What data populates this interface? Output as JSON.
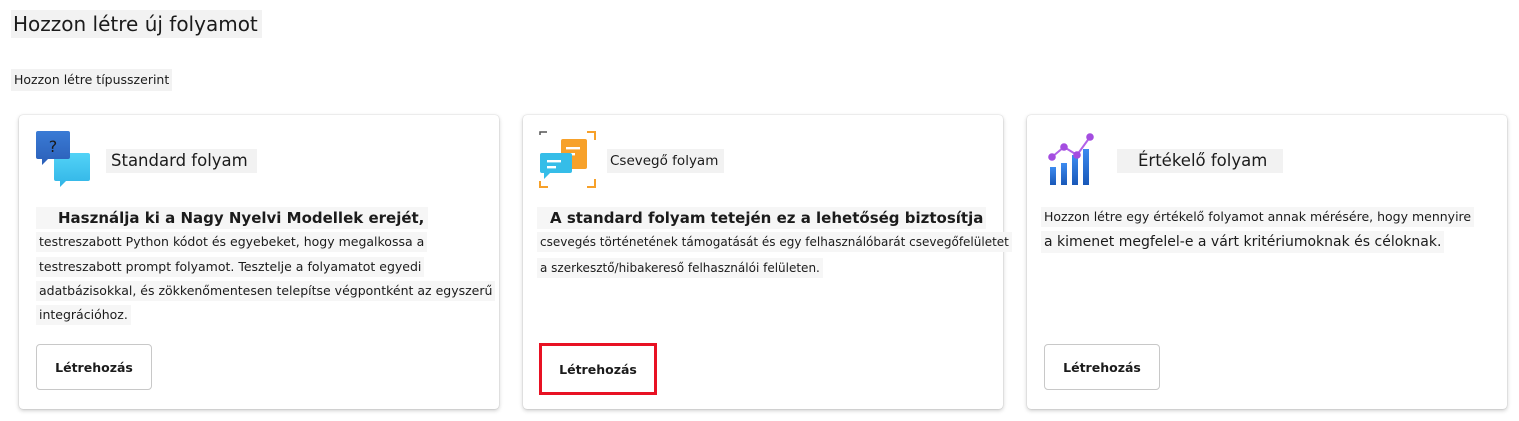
{
  "page_title": "Hozzon létre új folyamot",
  "section_label": "Hozzon létre típusszerint",
  "colors": {
    "highlight": "#e81123",
    "standard_icon_dark": "#3a7bd5",
    "standard_icon_light": "#40c8f4",
    "chat_icon_orange": "#f7a12a",
    "chat_icon_cyan": "#35bde8",
    "eval_icon_blue": "#1e6fd9",
    "eval_icon_purple": "#a44de0"
  },
  "cards": [
    {
      "icon": "chat-question-icon",
      "title": "Standard folyam",
      "description": [
        "Használja ki a Nagy Nyelvi Modellek erejét,",
        "testreszabott Python kódot és egyebeket, hogy megalkossa a",
        "testreszabott prompt folyamot. Tesztelje a folyamatot egyedi",
        "adatbázisokkal, és zökkenőmentesen telepítse végpontként az egyszerű",
        "integrációhoz."
      ],
      "button_label": "Létrehozás"
    },
    {
      "icon": "chat-bubbles-icon",
      "title": "Csevegő folyam",
      "description": [
        "A standard folyam tetején ez a lehetőség biztosítja",
        "csevegés történetének támogatását és egy felhasználóbarát csevegőfelületet",
        "a szerkesztő/hibakereső felhasználói felületen."
      ],
      "button_label": "Létrehozás"
    },
    {
      "icon": "evaluation-chart-icon",
      "title": "Értékelő folyam",
      "description": [
        "Hozzon létre egy értékelő folyamot annak mérésére, hogy mennyire",
        "a kimenet megfelel-e a várt kritériumoknak és céloknak."
      ],
      "button_label": "Létrehozás"
    }
  ]
}
